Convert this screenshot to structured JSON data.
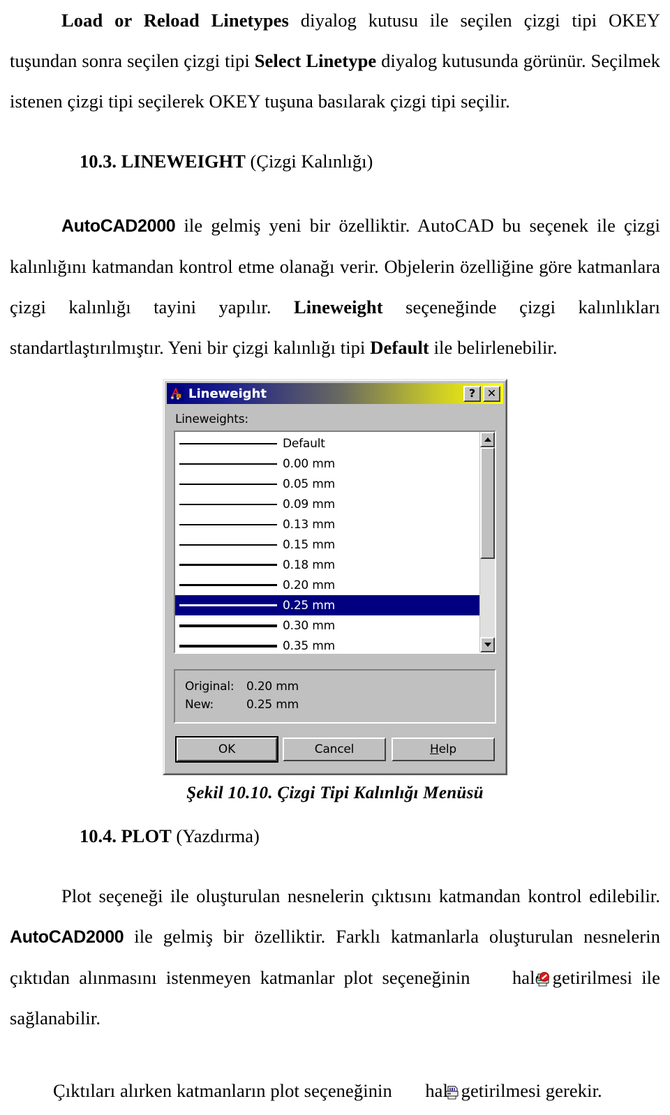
{
  "document": {
    "paragraphs": {
      "p1_a": "Load or Reload Linetypes",
      "p1_b": " diyalog kutusu ile seçilen çizgi tipi OKEY tuşundan sonra seçilen çizgi tipi ",
      "p1_c": "Select Linetype",
      "p1_d": " diyalog kutusunda görünür. Seçilmek istenen çizgi tipi seçilerek OKEY tuşuna basılarak çizgi tipi seçilir.",
      "p2_a": "AutoCAD2000",
      "p2_b": " ile gelmiş yeni bir özelliktir. AutoCAD bu seçenek ile çizgi kalınlığını katmandan kontrol etme olanağı verir. Objelerin özelliğine göre katmanlara çizgi kalınlığı tayini yapılır. ",
      "p2_c": "Lineweight",
      "p2_d": " seçeneğinde çizgi kalınlıkları standartlaştırılmıştır. Yeni bir çizgi kalınlığı tipi  ",
      "p2_e": "Default",
      "p2_f": " ile belirlenebilir.",
      "p3_a": "Plot seçeneği ile oluşturulan nesnelerin çıktısını katmandan kontrol edilebilir. ",
      "p3_b": "AutoCAD2000",
      "p3_c": " ile gelmiş bir özelliktir. Farklı katmanlarla oluşturulan nesnelerin çıktıdan alınmasını istenmeyen katmanlar plot seçeneğinin ",
      "p3_d": " hale getirilmesi ile sağlanabilir.",
      "p4_a": "Çıktıları alırken katmanların plot seçeneğinin ",
      "p4_b": " hale getirilmesi gerekir."
    },
    "headings": {
      "h1_num": "10.3.",
      "h1_title": " LINEWEIGHT",
      "h1_tr": " (Çizgi Kalınlığı)",
      "h2_num": "10.4.",
      "h2_title": " PLOT",
      "h2_tr": " (Yazdırma)"
    },
    "figure_caption": "Şekil 10.10. Çizgi Tipi Kalınlığı Menüsü",
    "inline_icons": {
      "plot_off": "printer-disabled-icon",
      "plot_on": "printer-icon"
    }
  },
  "dialog": {
    "title": "Lineweight",
    "app_icon": "autocad-logo-icon",
    "titlebar_buttons": [
      {
        "name": "help-button",
        "label": "?"
      },
      {
        "name": "close-button",
        "label": "✕"
      }
    ],
    "list_label": "Lineweights:",
    "lineweights": [
      {
        "label": "Default",
        "thickness_px": 2,
        "selected": false
      },
      {
        "label": "0.00 mm",
        "thickness_px": 2,
        "selected": false
      },
      {
        "label": "0.05 mm",
        "thickness_px": 2,
        "selected": false
      },
      {
        "label": "0.09 mm",
        "thickness_px": 2,
        "selected": false
      },
      {
        "label": "0.13 mm",
        "thickness_px": 2,
        "selected": false
      },
      {
        "label": "0.15 mm",
        "thickness_px": 2,
        "selected": false
      },
      {
        "label": "0.18 mm",
        "thickness_px": 3,
        "selected": false
      },
      {
        "label": "0.20 mm",
        "thickness_px": 3,
        "selected": false
      },
      {
        "label": "0.25 mm",
        "thickness_px": 3,
        "selected": true
      },
      {
        "label": "0.30 mm",
        "thickness_px": 4,
        "selected": false
      },
      {
        "label": "0.35 mm",
        "thickness_px": 4,
        "selected": false
      }
    ],
    "scrollbar": {
      "up_arrow": "scroll-up-icon",
      "down_arrow": "scroll-down-icon"
    },
    "info": {
      "original_label": "Original:",
      "original_value": "0.20 mm",
      "new_label": "New:",
      "new_value": "0.25 mm"
    },
    "buttons": {
      "ok": "OK",
      "cancel": "Cancel",
      "help_pre": "H",
      "help_post": "elp"
    },
    "colors": {
      "titlebar_start": "#000080",
      "titlebar_end": "#ffff00",
      "selection": "#000080",
      "face": "#c0c0c0"
    }
  }
}
